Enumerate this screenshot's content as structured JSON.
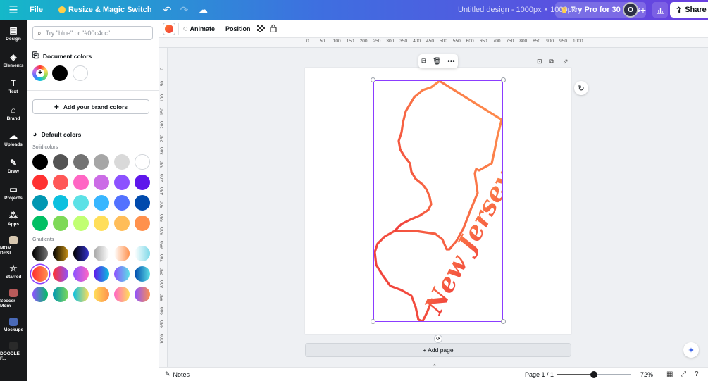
{
  "topbar": {
    "file_label": "File",
    "resize_label": "Resize & Magic Switch",
    "doc_title": "Untitled design - 1000px × 1000px",
    "try_pro_label": "Try Pro for 30 days",
    "avatar_initial": "O",
    "share_label": "Share"
  },
  "rail": [
    {
      "label": "Design",
      "icon": "design-icon"
    },
    {
      "label": "Elements",
      "icon": "elements-icon"
    },
    {
      "label": "Text",
      "icon": "text-icon"
    },
    {
      "label": "Brand",
      "icon": "brand-icon"
    },
    {
      "label": "Uploads",
      "icon": "uploads-icon"
    },
    {
      "label": "Draw",
      "icon": "draw-icon"
    },
    {
      "label": "Projects",
      "icon": "projects-icon"
    },
    {
      "label": "Apps",
      "icon": "apps-icon"
    },
    {
      "label": "MOM DESI...",
      "icon": "folder-thumb"
    },
    {
      "label": "Starred",
      "icon": "star-icon"
    },
    {
      "label": "Soccer Mom",
      "icon": "folder-thumb"
    },
    {
      "label": "Mockups",
      "icon": "folder-thumb"
    },
    {
      "label": "DOODLE F...",
      "icon": "folder-thumb"
    }
  ],
  "panel": {
    "search_placeholder": "Try \"blue\" or \"#00c4cc\"",
    "document_colors_title": "Document colors",
    "document_colors": [
      "#000000",
      "#ffffff"
    ],
    "brand_button_label": "Add your brand colors",
    "default_colors_title": "Default colors",
    "solid_colors_label": "Solid colors",
    "solid_colors": [
      [
        "#000000",
        "#545454",
        "#737373",
        "#a6a6a6",
        "#d9d9d9",
        "#ffffff"
      ],
      [
        "#ff3131",
        "#ff5757",
        "#ff66c4",
        "#cb6ce6",
        "#8c52ff",
        "#5e17eb"
      ],
      [
        "#0097b2",
        "#0cc0df",
        "#5ce1e6",
        "#38b6ff",
        "#5271ff",
        "#004aad"
      ],
      [
        "#00bf63",
        "#7ed957",
        "#c1ff72",
        "#ffde59",
        "#ffbd59",
        "#ff914d"
      ]
    ],
    "gradients_label": "Gradients",
    "gradients": [
      [
        [
          "#000000",
          "#737373"
        ],
        [
          "#000000",
          "#c89116"
        ],
        [
          "#000000",
          "#3533cd"
        ],
        [
          "#a6a6a6",
          "#ffffff"
        ],
        [
          "#ffffff",
          "#ff914d"
        ],
        [
          "#ffffff",
          "#7ed9e8"
        ]
      ],
      [
        [
          "#ff3131",
          "#ff914d"
        ],
        [
          "#ff3131",
          "#8c52ff"
        ],
        [
          "#8c52ff",
          "#ff66c4"
        ],
        [
          "#5e17eb",
          "#0cc0df"
        ],
        [
          "#8c52ff",
          "#5ce1e6"
        ],
        [
          "#004aad",
          "#5de0e6"
        ]
      ],
      [
        [
          "#8c52ff",
          "#00bf63"
        ],
        [
          "#0097b2",
          "#7ed957"
        ],
        [
          "#0cc0df",
          "#ffde59"
        ],
        [
          "#ffde59",
          "#ff914d"
        ],
        [
          "#ff66c4",
          "#ffde59"
        ],
        [
          "#8c52ff",
          "#ff914d"
        ]
      ]
    ]
  },
  "toolbar": {
    "animate_label": "Animate",
    "position_label": "Position"
  },
  "ruler": {
    "h_ticks": [
      "0",
      "50",
      "100",
      "150",
      "200",
      "250",
      "300",
      "350",
      "400",
      "450",
      "500",
      "550",
      "600",
      "650",
      "700",
      "750",
      "800",
      "850",
      "900",
      "950",
      "1000"
    ],
    "v_ticks": [
      "0",
      "50",
      "100",
      "150",
      "200",
      "250",
      "300",
      "350",
      "400",
      "450",
      "500",
      "550",
      "600",
      "650",
      "700",
      "750",
      "800",
      "850",
      "900",
      "950",
      "1000"
    ]
  },
  "canvas": {
    "artwork_text": "New Jersey",
    "outline_colors": [
      "#ef3a3a",
      "#ff914d"
    ],
    "add_page_label": "+ Add page"
  },
  "bottombar": {
    "notes_label": "Notes",
    "page_info": "Page 1 / 1",
    "zoom_label": "72%",
    "zoom_fraction": 0.5
  }
}
